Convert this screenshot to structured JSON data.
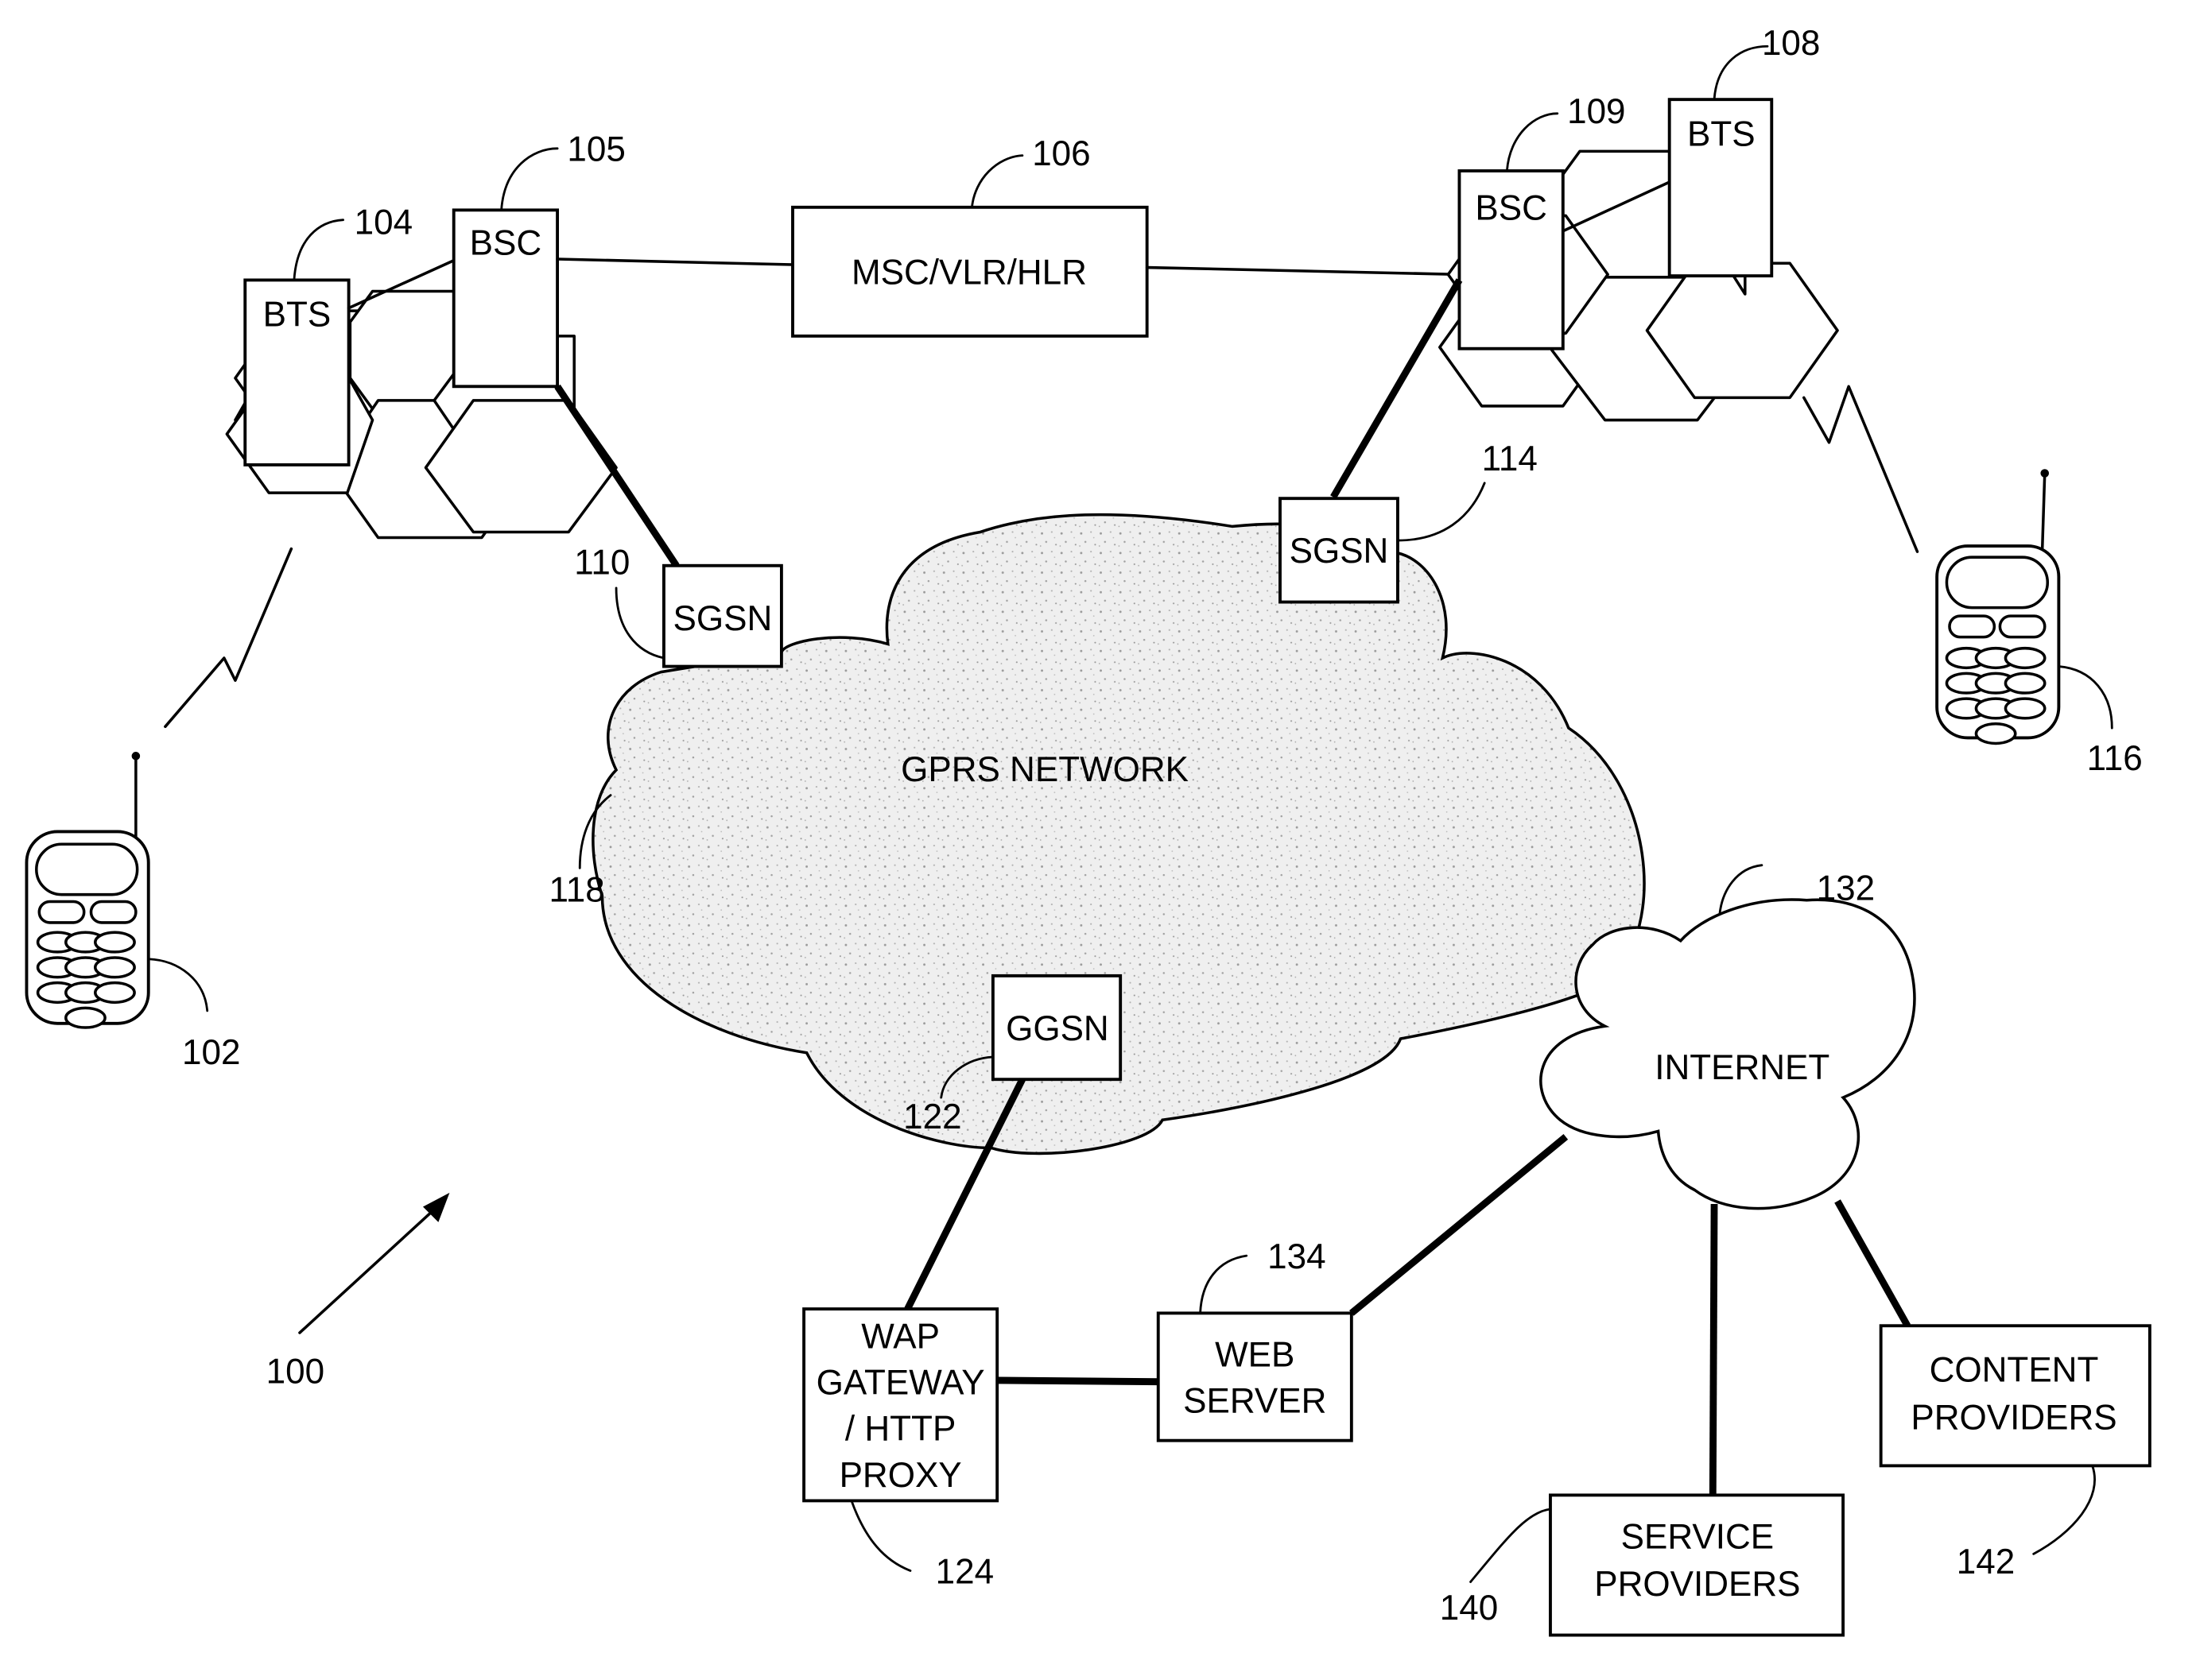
{
  "figure": {
    "system_ref": "100",
    "colors": {
      "line": "#000000",
      "background": "#ffffff",
      "cloud_fill": "#e6e6e6"
    }
  },
  "nodes": {
    "bts_left": {
      "label": "BTS",
      "ref": "104"
    },
    "bsc_left": {
      "label": "BSC",
      "ref": "105"
    },
    "msc": {
      "label": "MSC/VLR/HLR",
      "ref": "106"
    },
    "bts_right": {
      "label": "BTS",
      "ref": "108"
    },
    "bsc_right": {
      "label": "BSC",
      "ref": "109"
    },
    "sgsn_left": {
      "label": "SGSN",
      "ref": "110"
    },
    "sgsn_right": {
      "label": "SGSN",
      "ref": "114"
    },
    "gprs": {
      "label": "GPRS NETWORK",
      "ref": "118"
    },
    "ggsn": {
      "label": "GGSN",
      "ref": "122"
    },
    "wap": {
      "label_lines": [
        "WAP",
        "GATEWAY",
        "/ HTTP",
        "PROXY"
      ],
      "ref": "124"
    },
    "internet": {
      "label": "INTERNET",
      "ref": "132"
    },
    "web_server": {
      "label_lines": [
        "WEB",
        "SERVER"
      ],
      "ref": "134"
    },
    "service": {
      "label_lines": [
        "SERVICE",
        "PROVIDERS"
      ],
      "ref": "140"
    },
    "content": {
      "label_lines": [
        "CONTENT",
        "PROVIDERS"
      ],
      "ref": "142"
    },
    "phone_left": {
      "ref": "102"
    },
    "phone_right": {
      "ref": "116"
    }
  },
  "links": [
    {
      "from": "bts_left",
      "to": "bsc_left",
      "style": "thin"
    },
    {
      "from": "bsc_left",
      "to": "msc",
      "style": "thin"
    },
    {
      "from": "msc",
      "to": "bsc_right",
      "style": "thin"
    },
    {
      "from": "bsc_right",
      "to": "bts_right",
      "style": "thin"
    },
    {
      "from": "bsc_left",
      "to": "sgsn_left",
      "style": "thick"
    },
    {
      "from": "bsc_right",
      "to": "sgsn_right",
      "style": "thick"
    },
    {
      "from": "ggsn",
      "to": "wap",
      "style": "thick"
    },
    {
      "from": "wap",
      "to": "web_server",
      "style": "thick"
    },
    {
      "from": "web_server",
      "to": "internet",
      "style": "thick"
    },
    {
      "from": "internet",
      "to": "service",
      "style": "thick"
    },
    {
      "from": "internet",
      "to": "content",
      "style": "thick"
    },
    {
      "from": "phone_left",
      "to": "bts_left",
      "style": "wireless"
    },
    {
      "from": "phone_right",
      "to": "bts_right",
      "style": "wireless"
    }
  ]
}
